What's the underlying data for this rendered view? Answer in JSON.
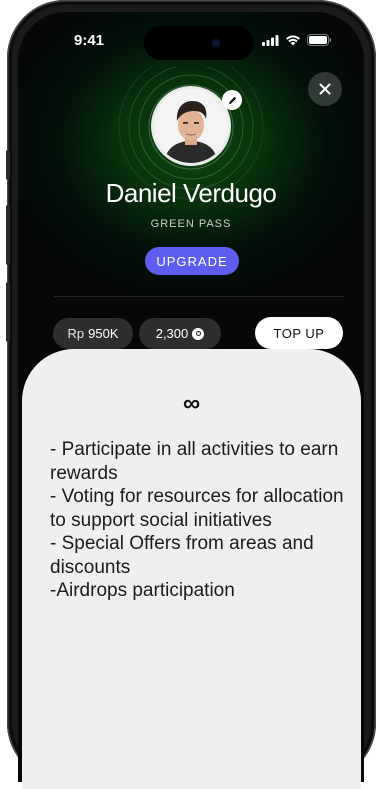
{
  "status_bar": {
    "time": "9:41"
  },
  "profile": {
    "name": "Daniel Verdugo",
    "pass_label": "GREEN PASS",
    "upgrade_label": "UPGRADE"
  },
  "wallet": {
    "balance_prefix": "Rp",
    "balance_value": "950K",
    "points": "2,300",
    "top_up_label": "TOP UP"
  },
  "benefits": {
    "icon": "∞",
    "items": [
      "- Participate in all activities to earn rewards",
      "- Voting for resources for allocation to support social initiatives",
      "- Special Offers from areas and discounts",
      "-Airdrops participation"
    ]
  },
  "colors": {
    "accent_green": "#0d4a12",
    "upgrade_purple": "#5d5df0",
    "sheet_bg": "#efefef"
  },
  "icons": {
    "close": "close-icon",
    "edit": "edit-pencil-icon",
    "signal": "cellular-signal-icon",
    "wifi": "wifi-icon",
    "battery": "battery-icon",
    "coin": "coin-icon"
  }
}
